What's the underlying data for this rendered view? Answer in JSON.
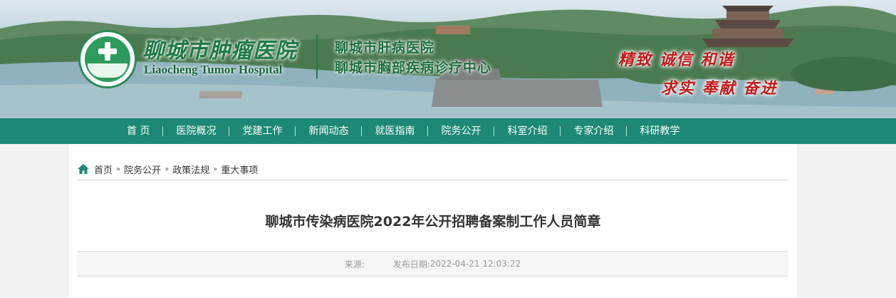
{
  "header": {
    "hospital_name_cn": "聊城市肿瘤医院",
    "hospital_name_en": "Liaocheng Tumor Hospital",
    "sub_names": [
      "聊城市肝病医院",
      "聊城市胸部疾病诊疗中心"
    ],
    "slogans": [
      "精致 诚信 和谐",
      "求实 奉献 奋进"
    ],
    "logo_icon": "hospital-logo-icon"
  },
  "nav": {
    "items": [
      "首 页",
      "医院概况",
      "党建工作",
      "新闻动态",
      "就医指南",
      "院务公开",
      "科室介绍",
      "专家介绍",
      "科研教学"
    ]
  },
  "breadcrumb": {
    "icon": "home-icon",
    "items": [
      "首页",
      "院务公开",
      "政策法规",
      "重大事项"
    ],
    "separator": "»"
  },
  "article": {
    "title": "聊城市传染病医院2022年公开招聘备案制工作人员简章",
    "source_label": "来源:",
    "date_label": "发布日期:",
    "date_value": "2022-04-21 12:03:22"
  },
  "colors": {
    "nav_bg": "#1d8876",
    "brand_green": "#1e7a47",
    "slogan_red": "#c21a1a"
  }
}
